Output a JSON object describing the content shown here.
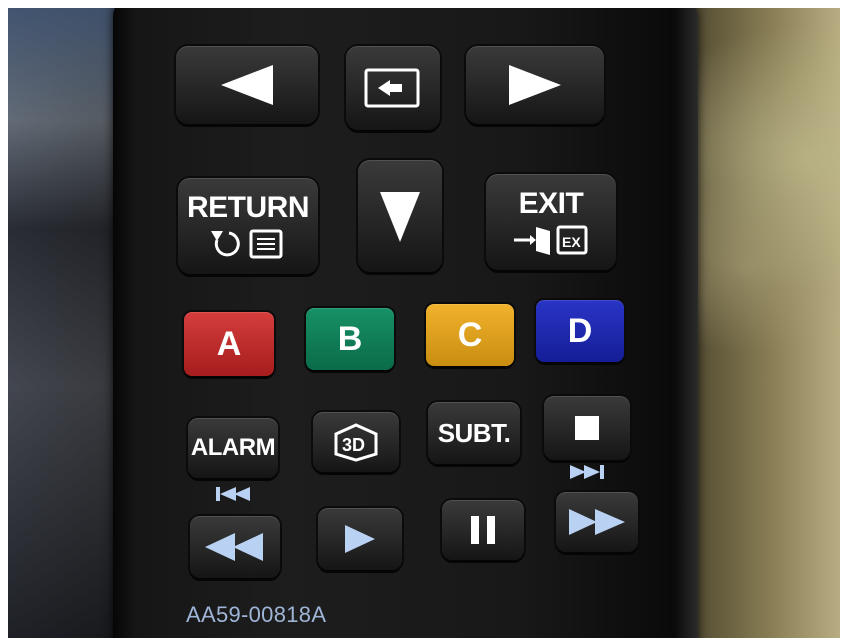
{
  "remote": {
    "model_number": "AA59-00818A",
    "buttons": {
      "left": "left-arrow-icon",
      "source": "source-icon",
      "right": "right-arrow-icon",
      "down": "down-arrow-icon",
      "return_label": "RETURN",
      "exit_label": "EXIT",
      "color_a": "A",
      "color_b": "B",
      "color_c": "C",
      "color_d": "D",
      "alarm_label": "ALARM",
      "three_d": "3D",
      "subt_label": "SUBT.",
      "stop": "stop-icon",
      "rewind": "rewind-icon",
      "play": "play-icon",
      "pause": "pause-icon",
      "fast_forward": "fast-forward-icon",
      "skip_back": "skip-back-icon",
      "skip_forward": "skip-forward-icon"
    },
    "colors": {
      "red": "#c02b2b",
      "green": "#0f7d56",
      "yellow": "#e0a11e",
      "blue": "#1e28b0",
      "transport_icon": "#b9d1f2"
    }
  }
}
